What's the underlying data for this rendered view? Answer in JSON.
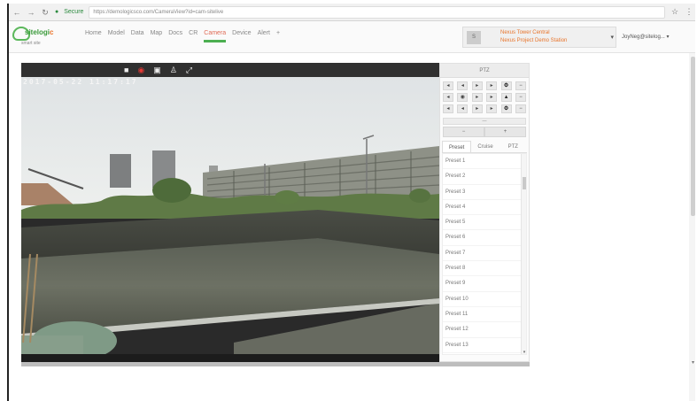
{
  "browser": {
    "secure_label": "Secure",
    "url": "https://demologicsco.com/CameraView?id=cam-sitelive"
  },
  "app": {
    "logo_text_main": "sitelogi",
    "logo_text_accent": "c",
    "logo_sub": "smart site",
    "nav": [
      {
        "label": "Home"
      },
      {
        "label": "Model"
      },
      {
        "label": "Data"
      },
      {
        "label": "Map"
      },
      {
        "label": "Docs"
      },
      {
        "label": "CR"
      },
      {
        "label": "Camera"
      },
      {
        "label": "Device"
      },
      {
        "label": "Alert"
      },
      {
        "label": "+"
      }
    ],
    "active_nav": "Camera",
    "site": {
      "icon_text": "S",
      "name": "Nexus Tower Central",
      "subtitle": "Nexus Project Demo Station"
    },
    "user": "JoyNeg@sitelog..."
  },
  "video": {
    "timestamp": "2017-05-22 11:17:17",
    "toolbar_icons": [
      "stop-icon",
      "record-icon",
      "snapshot-icon",
      "person-icon",
      "fullscreen-icon"
    ]
  },
  "ptz": {
    "title": "PTZ",
    "rows": [
      [
        "◂",
        "◂",
        "▸",
        "▸",
        "⚙",
        "−"
      ],
      [
        "◂",
        "◉",
        "▸",
        "▸",
        "▲",
        "−"
      ],
      [
        "◂",
        "◂",
        "▸",
        "▸",
        "⚙",
        "−"
      ]
    ],
    "speed_label": "—",
    "zoom_out": "−",
    "zoom_in": "+",
    "tabs": [
      "Preset",
      "Cruise",
      "PTZ"
    ],
    "active_tab": "Preset",
    "presets": [
      "Preset 1",
      "Preset 2",
      "Preset 3",
      "Preset 4",
      "Preset 5",
      "Preset 6",
      "Preset 7",
      "Preset 8",
      "Preset 9",
      "Preset 10",
      "Preset 11",
      "Preset 12",
      "Preset 13"
    ]
  },
  "colors": {
    "brand_green": "#4caf50",
    "accent_orange": "#e8742b",
    "record_red": "#e53935"
  }
}
